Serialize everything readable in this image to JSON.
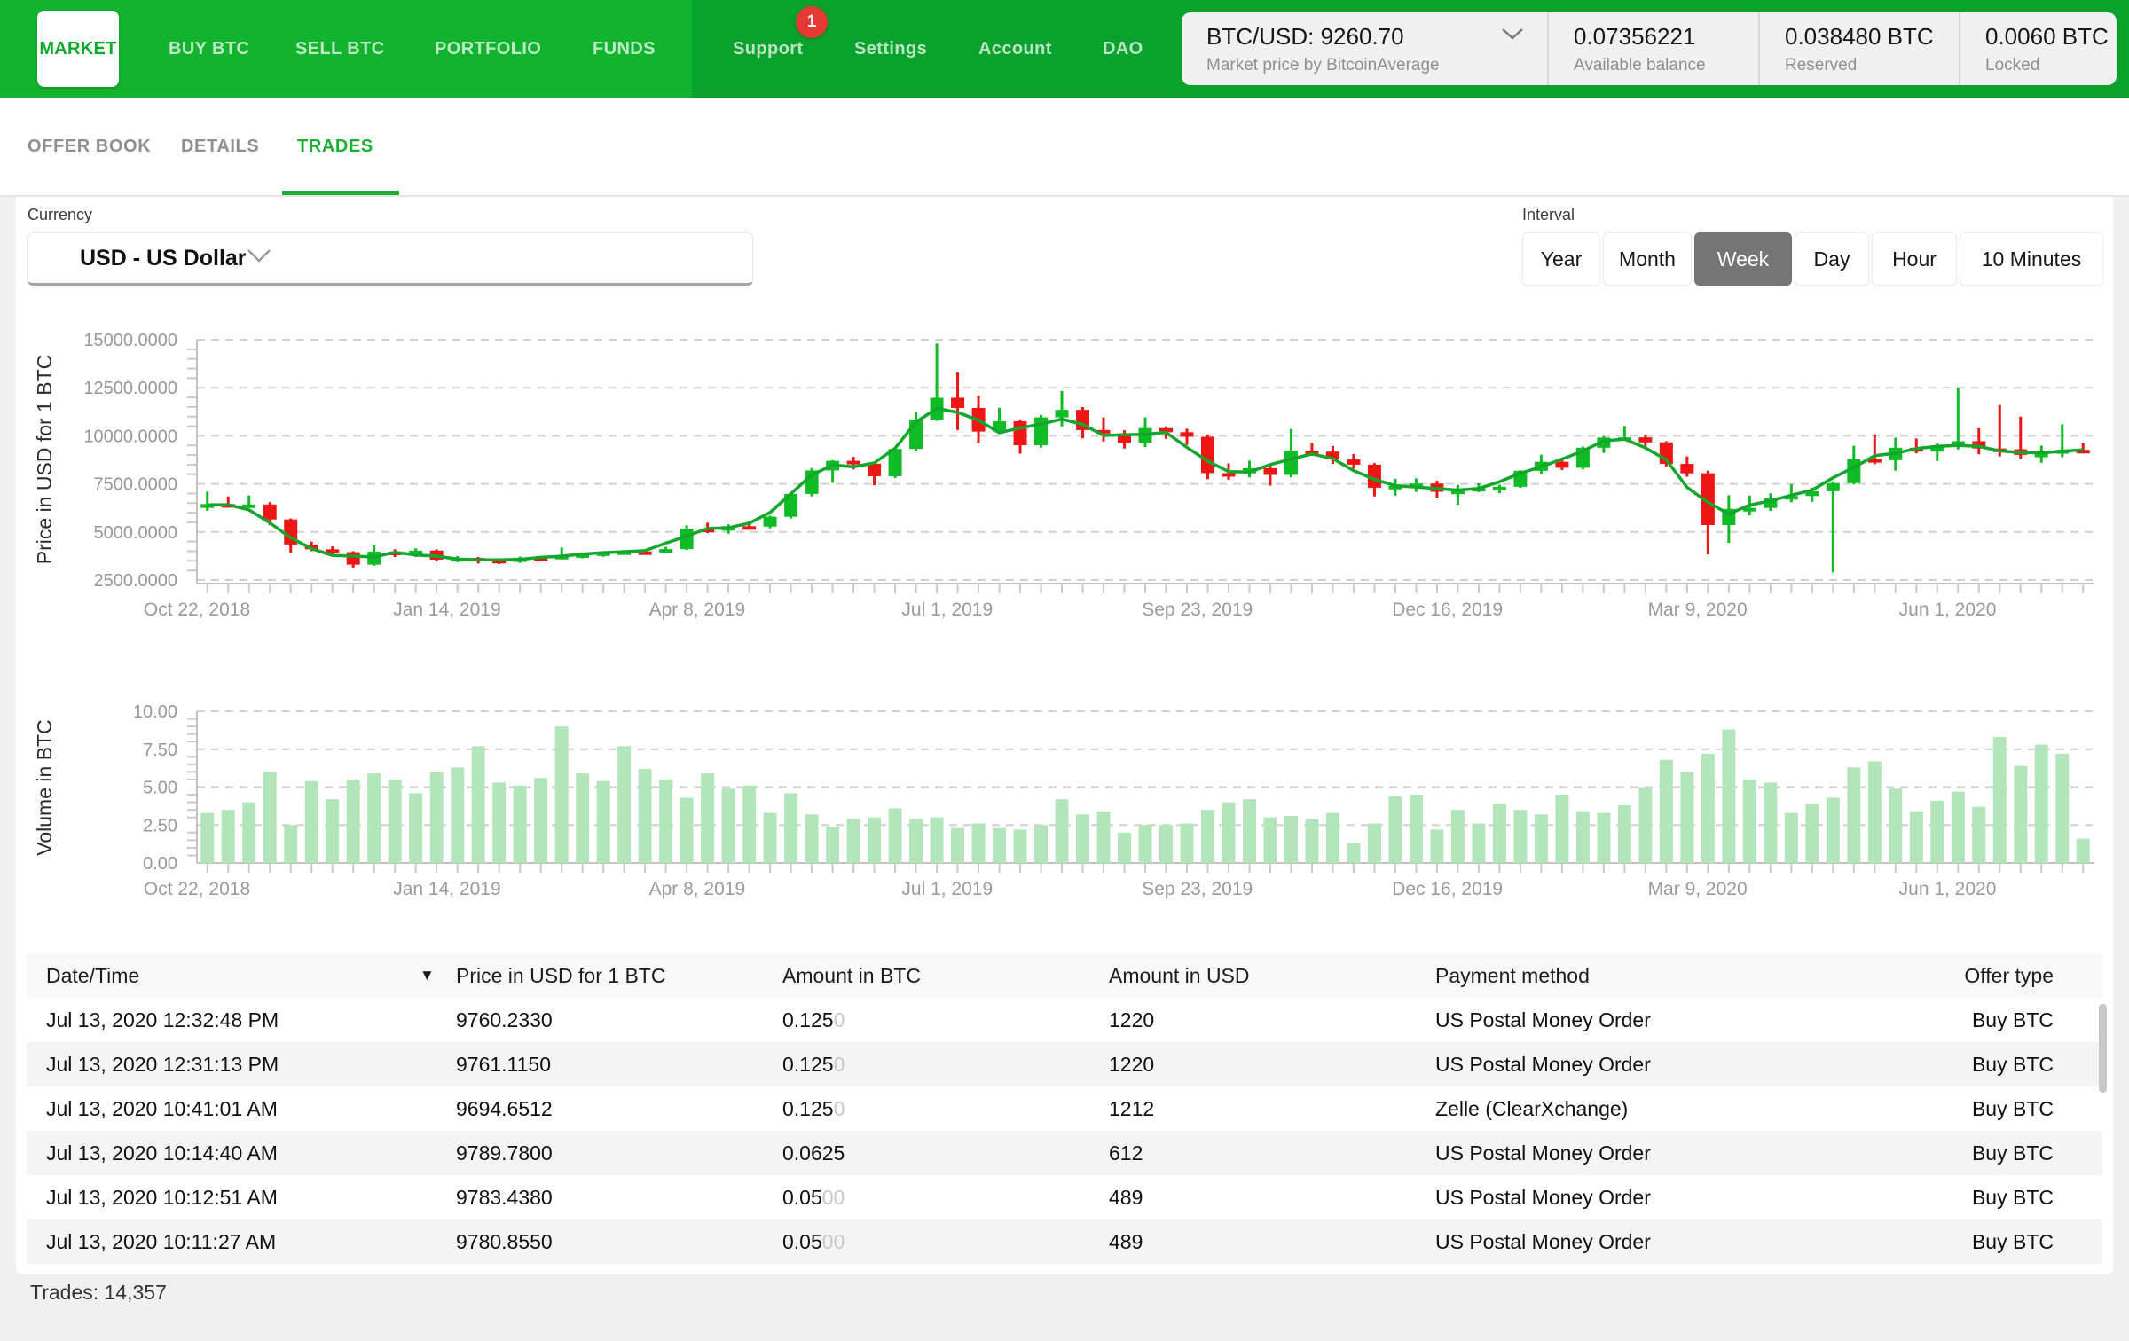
{
  "nav": {
    "items": [
      {
        "label": "MARKET",
        "active": true
      },
      {
        "label": "BUY BTC",
        "active": false
      },
      {
        "label": "SELL BTC",
        "active": false
      },
      {
        "label": "PORTFOLIO",
        "active": false
      },
      {
        "label": "FUNDS",
        "active": false
      }
    ],
    "right_items": [
      {
        "label": "Support"
      },
      {
        "label": "Settings"
      },
      {
        "label": "Account"
      },
      {
        "label": "DAO"
      }
    ],
    "support_badge": "1",
    "price_widget": {
      "pair_price": "BTC/USD: 9260.70",
      "source": "Market price by BitcoinAverage"
    },
    "balances": [
      {
        "value": "0.07356221",
        "label": "Available balance"
      },
      {
        "value": "0.038480 BTC",
        "label": "Reserved"
      },
      {
        "value": "0.0060 BTC",
        "label": "Locked"
      }
    ]
  },
  "tabs": [
    {
      "label": "OFFER BOOK",
      "active": false
    },
    {
      "label": "DETAILS",
      "active": false
    },
    {
      "label": "TRADES",
      "active": true
    }
  ],
  "filters": {
    "currency_label": "Currency",
    "currency_value": "USD  -  US Dollar",
    "interval_label": "Interval",
    "intervals": [
      {
        "label": "Year",
        "selected": false
      },
      {
        "label": "Month",
        "selected": false
      },
      {
        "label": "Week",
        "selected": true
      },
      {
        "label": "Day",
        "selected": false
      },
      {
        "label": "Hour",
        "selected": false
      },
      {
        "label": "10 Minutes",
        "selected": false
      }
    ]
  },
  "colors": {
    "nav_green": "#12b42f",
    "nav_green_dark": "#09a22c",
    "accent_green": "#1fae35",
    "candle_up": "#10bc26",
    "candle_down": "#ee1515",
    "ma_line": "#12a62c",
    "volume_bar": "#b3e5bb",
    "badge_red": "#e53935",
    "selected_interval_bg": "#757575",
    "gridline": "#d0d0d0",
    "axis": "#c2c2c2",
    "tick_label": "#979797"
  },
  "icons": {
    "price_widget": "chevron-down-icon",
    "currency_dropdown": "chevron-down-icon",
    "table_sort": "sort-descending-icon"
  },
  "chart_data": [
    {
      "type": "candlestick",
      "ylabel": "Price in USD for 1 BTC",
      "ylim": [
        2500,
        15000
      ],
      "grid": true,
      "y_ticks": [
        "15000.0000",
        "12500.0000",
        "10000.0000",
        "7500.0000",
        "5000.0000",
        "2500.0000"
      ],
      "x_tick_labels": [
        {
          "index": 0,
          "label": "Oct 22, 2018"
        },
        {
          "index": 12,
          "label": "Jan 14, 2019"
        },
        {
          "index": 24,
          "label": "Apr 8, 2019"
        },
        {
          "index": 36,
          "label": "Jul 1, 2019"
        },
        {
          "index": 48,
          "label": "Sep 23, 2019"
        },
        {
          "index": 60,
          "label": "Dec 16, 2019"
        },
        {
          "index": 72,
          "label": "Mar 9, 2020"
        },
        {
          "index": 84,
          "label": "Jun 1, 2020"
        }
      ],
      "candles": [
        [
          6250,
          7100,
          6100,
          6450
        ],
        [
          6450,
          6850,
          6300,
          6370
        ],
        [
          6370,
          6900,
          6280,
          6430
        ],
        [
          6430,
          6550,
          5350,
          5650
        ],
        [
          5650,
          5700,
          3900,
          4350
        ],
        [
          4350,
          4500,
          4000,
          4100
        ],
        [
          4100,
          4250,
          3850,
          3950
        ],
        [
          3950,
          4000,
          3150,
          3300
        ],
        [
          3300,
          4300,
          3250,
          3980
        ],
        [
          3980,
          4100,
          3700,
          3820
        ],
        [
          3820,
          4150,
          3700,
          4030
        ],
        [
          4030,
          4100,
          3470,
          3560
        ],
        [
          3560,
          3750,
          3430,
          3650
        ],
        [
          3650,
          3700,
          3360,
          3550
        ],
        [
          3550,
          3600,
          3330,
          3440
        ],
        [
          3440,
          3720,
          3390,
          3660
        ],
        [
          3660,
          3700,
          3460,
          3620
        ],
        [
          3620,
          4190,
          3570,
          3760
        ],
        [
          3760,
          3900,
          3630,
          3840
        ],
        [
          3840,
          3980,
          3710,
          3940
        ],
        [
          3940,
          4060,
          3820,
          3990
        ],
        [
          3990,
          4080,
          3880,
          3980
        ],
        [
          3980,
          4230,
          3900,
          4110
        ],
        [
          4110,
          5350,
          4060,
          5170
        ],
        [
          5170,
          5480,
          4940,
          5070
        ],
        [
          5070,
          5400,
          4910,
          5300
        ],
        [
          5300,
          5560,
          5140,
          5280
        ],
        [
          5280,
          5850,
          5190,
          5790
        ],
        [
          5790,
          7060,
          5700,
          6980
        ],
        [
          6980,
          8330,
          6850,
          8200
        ],
        [
          8200,
          8730,
          7550,
          8700
        ],
        [
          8700,
          8910,
          8250,
          8550
        ],
        [
          8550,
          8600,
          7430,
          7900
        ],
        [
          7900,
          9400,
          7800,
          9320
        ],
        [
          9320,
          11260,
          9220,
          10850
        ],
        [
          10850,
          14800,
          10780,
          11980
        ],
        [
          11980,
          13300,
          10300,
          11450
        ],
        [
          11450,
          12100,
          9650,
          10220
        ],
        [
          10220,
          11460,
          10090,
          10760
        ],
        [
          10760,
          10860,
          9070,
          9510
        ],
        [
          9510,
          11090,
          9380,
          10960
        ],
        [
          10960,
          12330,
          10490,
          11350
        ],
        [
          11350,
          11490,
          9870,
          10300
        ],
        [
          10300,
          10960,
          9710,
          10130
        ],
        [
          10130,
          10290,
          9340,
          9630
        ],
        [
          9630,
          10960,
          9410,
          10400
        ],
        [
          10400,
          10490,
          9840,
          10190
        ],
        [
          10190,
          10370,
          9530,
          9950
        ],
        [
          9950,
          10060,
          7740,
          8060
        ],
        [
          8060,
          8570,
          7710,
          8050
        ],
        [
          8050,
          8710,
          7840,
          8320
        ],
        [
          8320,
          8430,
          7410,
          7970
        ],
        [
          7970,
          10360,
          7840,
          9230
        ],
        [
          9230,
          9600,
          8960,
          9180
        ],
        [
          9180,
          9470,
          8540,
          8770
        ],
        [
          8770,
          9060,
          8290,
          8500
        ],
        [
          8500,
          8580,
          6850,
          7300
        ],
        [
          7300,
          7770,
          6890,
          7400
        ],
        [
          7400,
          7790,
          7080,
          7520
        ],
        [
          7520,
          7660,
          6780,
          7090
        ],
        [
          7090,
          7450,
          6420,
          7150
        ],
        [
          7150,
          7530,
          7070,
          7290
        ],
        [
          7290,
          7460,
          7010,
          7350
        ],
        [
          7350,
          8210,
          7290,
          8180
        ],
        [
          8180,
          9020,
          8010,
          8650
        ],
        [
          8650,
          8760,
          8220,
          8340
        ],
        [
          8340,
          9450,
          8260,
          9380
        ],
        [
          9380,
          9970,
          9110,
          9910
        ],
        [
          9910,
          10510,
          9740,
          9920
        ],
        [
          9920,
          10060,
          9370,
          9660
        ],
        [
          9660,
          9720,
          8410,
          8540
        ],
        [
          8540,
          8930,
          7870,
          8050
        ],
        [
          8050,
          8190,
          3840,
          5360
        ],
        [
          5360,
          6910,
          4440,
          6200
        ],
        [
          6200,
          6890,
          5860,
          6250
        ],
        [
          6250,
          7010,
          6090,
          6740
        ],
        [
          6740,
          7480,
          6550,
          6870
        ],
        [
          6870,
          7300,
          6570,
          7120
        ],
        [
          7120,
          7630,
          2900,
          7540
        ],
        [
          7540,
          9480,
          7470,
          8790
        ],
        [
          8790,
          10080,
          8520,
          8730
        ],
        [
          8730,
          9910,
          8190,
          9380
        ],
        [
          9380,
          9860,
          9090,
          9180
        ],
        [
          9180,
          9610,
          8690,
          9450
        ],
        [
          9450,
          12500,
          9290,
          9720
        ],
        [
          9720,
          10390,
          9040,
          9340
        ],
        [
          9340,
          11600,
          8930,
          9300
        ],
        [
          9300,
          11000,
          8820,
          9010
        ],
        [
          9010,
          9490,
          8600,
          9070
        ],
        [
          9070,
          10600,
          8890,
          9270
        ],
        [
          9270,
          9610,
          9090,
          9260
        ]
      ]
    },
    {
      "type": "bar",
      "ylabel": "Volume in BTC",
      "ylim": [
        0,
        10
      ],
      "grid": true,
      "y_ticks": [
        "10.00",
        "7.50",
        "5.00",
        "2.50",
        "0.00"
      ],
      "x_tick_labels": [
        {
          "index": 0,
          "label": "Oct 22, 2018"
        },
        {
          "index": 12,
          "label": "Jan 14, 2019"
        },
        {
          "index": 24,
          "label": "Apr 8, 2019"
        },
        {
          "index": 36,
          "label": "Jul 1, 2019"
        },
        {
          "index": 48,
          "label": "Sep 23, 2019"
        },
        {
          "index": 60,
          "label": "Dec 16, 2019"
        },
        {
          "index": 72,
          "label": "Mar 9, 2020"
        },
        {
          "index": 84,
          "label": "Jun 1, 2020"
        }
      ],
      "values": [
        3.3,
        3.5,
        4.0,
        6.0,
        2.5,
        5.4,
        4.2,
        5.5,
        5.9,
        5.5,
        4.6,
        6.0,
        6.3,
        7.7,
        5.3,
        5.1,
        5.6,
        9.0,
        5.9,
        5.4,
        7.7,
        6.2,
        5.5,
        4.3,
        5.9,
        4.9,
        5.1,
        3.3,
        4.6,
        3.2,
        2.4,
        2.9,
        3.0,
        3.6,
        2.9,
        3.0,
        2.3,
        2.6,
        2.3,
        2.2,
        2.5,
        4.2,
        3.2,
        3.4,
        2.0,
        2.5,
        2.5,
        2.6,
        3.5,
        4.0,
        4.2,
        3.0,
        3.1,
        2.9,
        3.3,
        1.3,
        2.6,
        4.4,
        4.5,
        2.2,
        3.5,
        2.6,
        3.9,
        3.5,
        3.2,
        4.5,
        3.4,
        3.3,
        3.8,
        5.0,
        6.8,
        6.0,
        7.2,
        8.8,
        5.5,
        5.3,
        3.3,
        3.9,
        4.3,
        6.3,
        6.7,
        4.9,
        3.4,
        4.1,
        4.7,
        3.7,
        8.3,
        6.4,
        7.8,
        7.2,
        1.6
      ]
    }
  ],
  "table": {
    "headers": [
      "Date/Time",
      "Price in USD for 1 BTC",
      "Amount in BTC",
      "Amount in USD",
      "Payment method",
      "Offer type"
    ],
    "sort_icon": "▼",
    "rows": [
      {
        "datetime": "Jul 13, 2020 12:32:48 PM",
        "price": "9760.2330",
        "amount_btc": "0.125",
        "amount_btc_faded": "0",
        "amount_usd": "1220",
        "payment": "US Postal Money Order",
        "offer": "Buy BTC"
      },
      {
        "datetime": "Jul 13, 2020 12:31:13 PM",
        "price": "9761.1150",
        "amount_btc": "0.125",
        "amount_btc_faded": "0",
        "amount_usd": "1220",
        "payment": "US Postal Money Order",
        "offer": "Buy BTC"
      },
      {
        "datetime": "Jul 13, 2020 10:41:01 AM",
        "price": "9694.6512",
        "amount_btc": "0.125",
        "amount_btc_faded": "0",
        "amount_usd": "1212",
        "payment": "Zelle (ClearXchange)",
        "offer": "Buy BTC"
      },
      {
        "datetime": "Jul 13, 2020 10:14:40 AM",
        "price": "9789.7800",
        "amount_btc": "0.0625",
        "amount_btc_faded": "",
        "amount_usd": "612",
        "payment": "US Postal Money Order",
        "offer": "Buy BTC"
      },
      {
        "datetime": "Jul 13, 2020 10:12:51 AM",
        "price": "9783.4380",
        "amount_btc": "0.05",
        "amount_btc_faded": "00",
        "amount_usd": "489",
        "payment": "US Postal Money Order",
        "offer": "Buy BTC"
      },
      {
        "datetime": "Jul 13, 2020 10:11:27 AM",
        "price": "9780.8550",
        "amount_btc": "0.05",
        "amount_btc_faded": "00",
        "amount_usd": "489",
        "payment": "US Postal Money Order",
        "offer": "Buy BTC"
      }
    ]
  },
  "footer": {
    "trades_label": "Trades: 14,357"
  }
}
